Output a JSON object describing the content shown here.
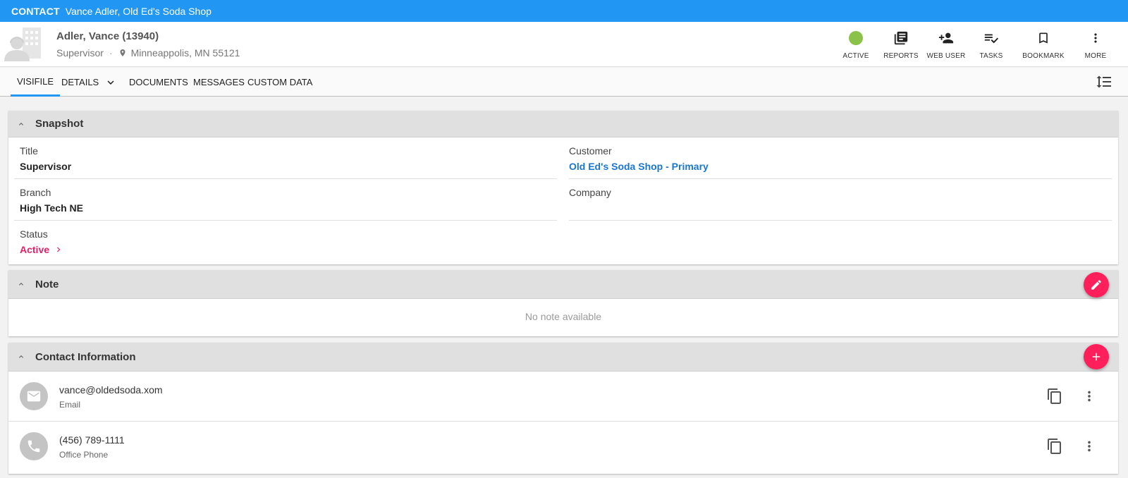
{
  "topbar": {
    "kind": "CONTACT",
    "title": "Vance Adler, Old Ed's Soda Shop"
  },
  "header": {
    "name": "Adler, Vance (13940)",
    "title": "Supervisor",
    "separator": "·",
    "location": "Minneappolis, MN 55121",
    "actions": [
      {
        "label": "ACTIVE",
        "icon": "status-dot"
      },
      {
        "label": "REPORTS",
        "icon": "reports-icon"
      },
      {
        "label": "WEB USER",
        "icon": "person-add-icon"
      },
      {
        "label": "TASKS",
        "icon": "tasks-icon"
      },
      {
        "label": "BOOKMARK",
        "icon": "bookmark-icon"
      },
      {
        "label": "MORE",
        "icon": "more-vert-icon"
      }
    ]
  },
  "tabs": [
    "VISIFILE",
    "DETAILS",
    "DOCUMENTS",
    "MESSAGES",
    "CUSTOM DATA"
  ],
  "snapshot": {
    "heading": "Snapshot",
    "title_label": "Title",
    "title_value": "Supervisor",
    "customer_label": "Customer",
    "customer_value": "Old Ed's Soda Shop - Primary",
    "branch_label": "Branch",
    "branch_value": "High Tech NE",
    "company_label": "Company",
    "company_value": "",
    "status_label": "Status",
    "status_value": "Active"
  },
  "note": {
    "heading": "Note",
    "empty_text": "No note available"
  },
  "contact_info": {
    "heading": "Contact Information",
    "items": [
      {
        "value": "vance@oldedsoda.xom",
        "type": "Email",
        "icon": "email-icon"
      },
      {
        "value": "(456) 789-1111",
        "type": "Office Phone",
        "icon": "phone-icon"
      }
    ]
  },
  "colors": {
    "topbar": "#2196f3",
    "accent": "#ff1f5a",
    "status_active": "#8bc34a",
    "link": "#1976d2"
  }
}
